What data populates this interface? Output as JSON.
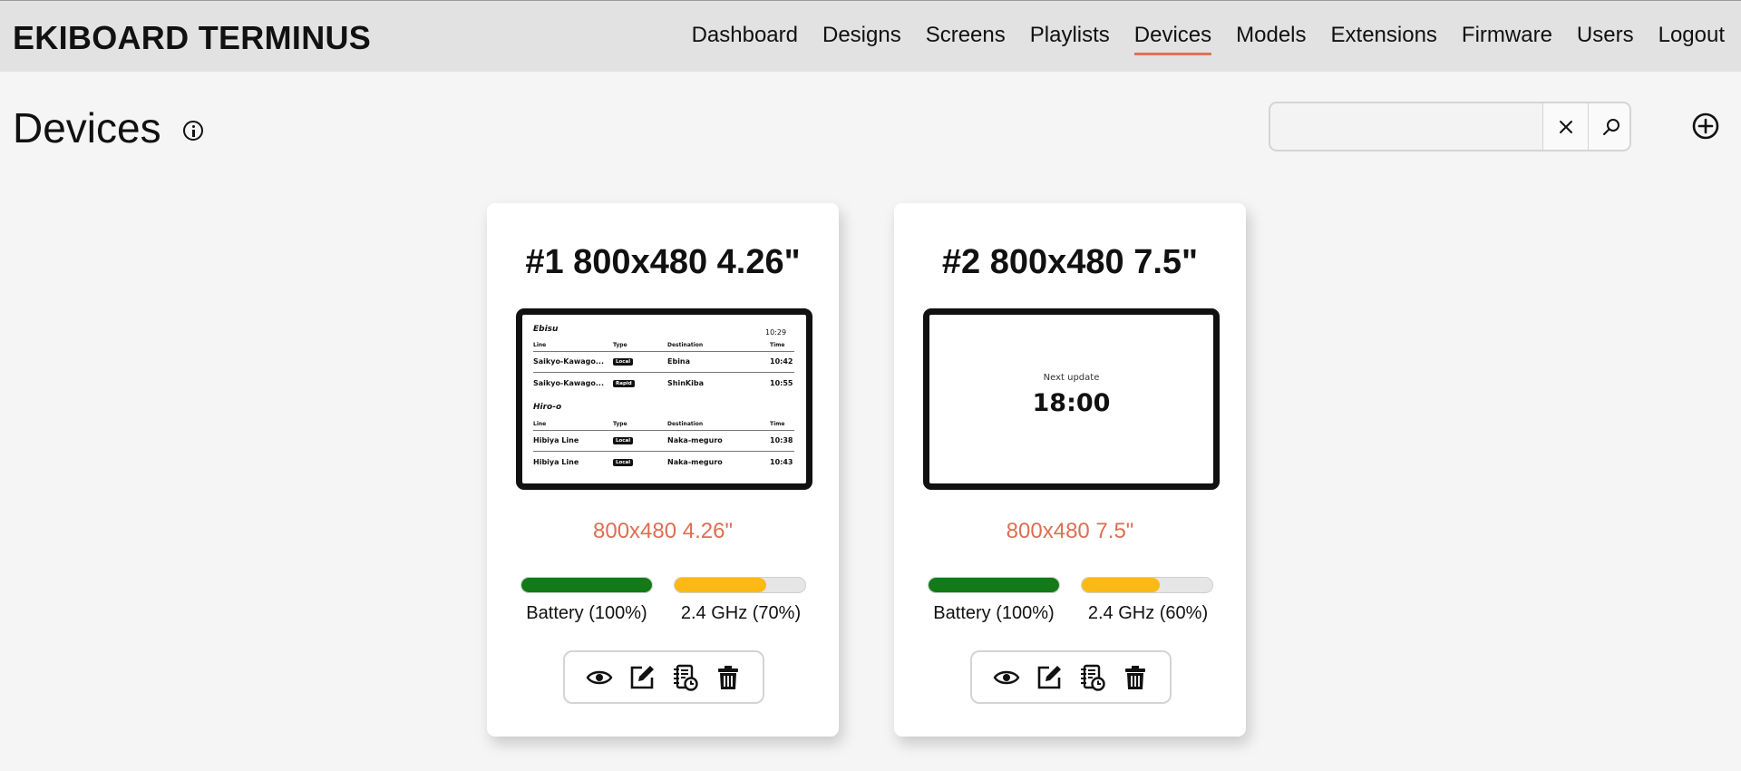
{
  "brand": "EKIBOARD TERMINUS",
  "nav": [
    "Dashboard",
    "Designs",
    "Screens",
    "Playlists",
    "Devices",
    "Models",
    "Extensions",
    "Firmware",
    "Users",
    "Logout"
  ],
  "nav_active": "Devices",
  "page_title": "Devices",
  "search": {
    "value": "",
    "placeholder": ""
  },
  "icons": {
    "info": "info-icon",
    "clear": "close-icon",
    "search": "search-icon",
    "add": "plus-circle-icon",
    "view": "eye-icon",
    "edit": "edit-icon",
    "logs": "log-icon",
    "delete": "trash-icon"
  },
  "colors": {
    "accent": "#e0715a",
    "model_label": "#dd6e52",
    "battery": "#127a16",
    "wifi": "#fbb914"
  },
  "devices": [
    {
      "title": "#1 800x480 4.26\"",
      "model": "800x480 4.26\"",
      "battery_label": "Battery (100%)",
      "battery_pct": 100,
      "wifi_label": "2.4 GHz (70%)",
      "wifi_pct": 70,
      "preview": {
        "kind": "timetable",
        "station1": "Ebisu",
        "clock": "10:29",
        "headers": [
          "Line",
          "Type",
          "Destination",
          "Time"
        ],
        "rows1": [
          [
            "Saikyo-Kawago...",
            "Local",
            "Ebina",
            "10:42"
          ],
          [
            "Saikyo-Kawago...",
            "Rapid",
            "ShinKiba",
            "10:55"
          ]
        ],
        "station2": "Hiro-o",
        "rows2": [
          [
            "Hibiya Line",
            "Local",
            "Naka-meguro",
            "10:38"
          ],
          [
            "Hibiya Line",
            "Local",
            "Naka-meguro",
            "10:43"
          ]
        ]
      }
    },
    {
      "title": "#2 800x480 7.5\"",
      "model": "800x480 7.5\"",
      "battery_label": "Battery (100%)",
      "battery_pct": 100,
      "wifi_label": "2.4 GHz (60%)",
      "wifi_pct": 60,
      "preview": {
        "kind": "next-update",
        "label": "Next update",
        "time": "18:00"
      }
    }
  ]
}
